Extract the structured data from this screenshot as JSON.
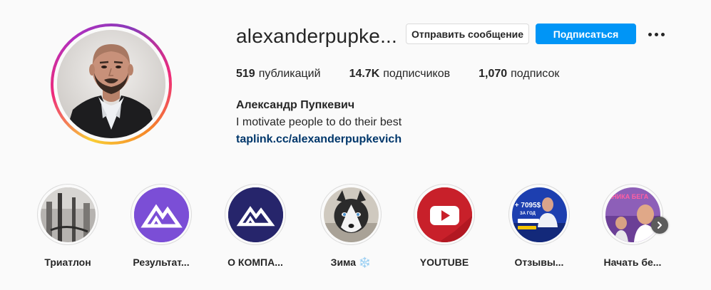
{
  "header": {
    "username": "alexanderpupke...",
    "message_button": "Отправить сообщение",
    "follow_button": "Подписаться",
    "more_icon": "more-horizontal-icon"
  },
  "stats": {
    "posts_count": "519",
    "posts_label": "публикаций",
    "followers_count": "14.7K",
    "followers_label": "подписчиков",
    "following_count": "1,070",
    "following_label": "подписок"
  },
  "profile": {
    "full_name": "Александр Пупкевич",
    "bio": "I motivate people to do their best",
    "link": "taplink.cc/alexanderpupkevich"
  },
  "highlights": [
    {
      "label": "Триатлон"
    },
    {
      "label": "Результат..."
    },
    {
      "label": "О КОМПА..."
    },
    {
      "label": "Зима ❄️"
    },
    {
      "label": "YOUTUBE"
    },
    {
      "label": "Отзывы..."
    },
    {
      "label": "Начать бе..."
    }
  ],
  "highlight_art_text": {
    "reviews_amount": "+ 7095$",
    "reviews_period": "ЗА ГОД",
    "start_running": "ТЕХНИКА БЕГА"
  },
  "colors": {
    "follow_blue": "#0095f6",
    "link_blue": "#00376b",
    "brand_purple": "#7b4ed6",
    "brand_navy": "#26256b",
    "youtube_red": "#c8202a"
  }
}
